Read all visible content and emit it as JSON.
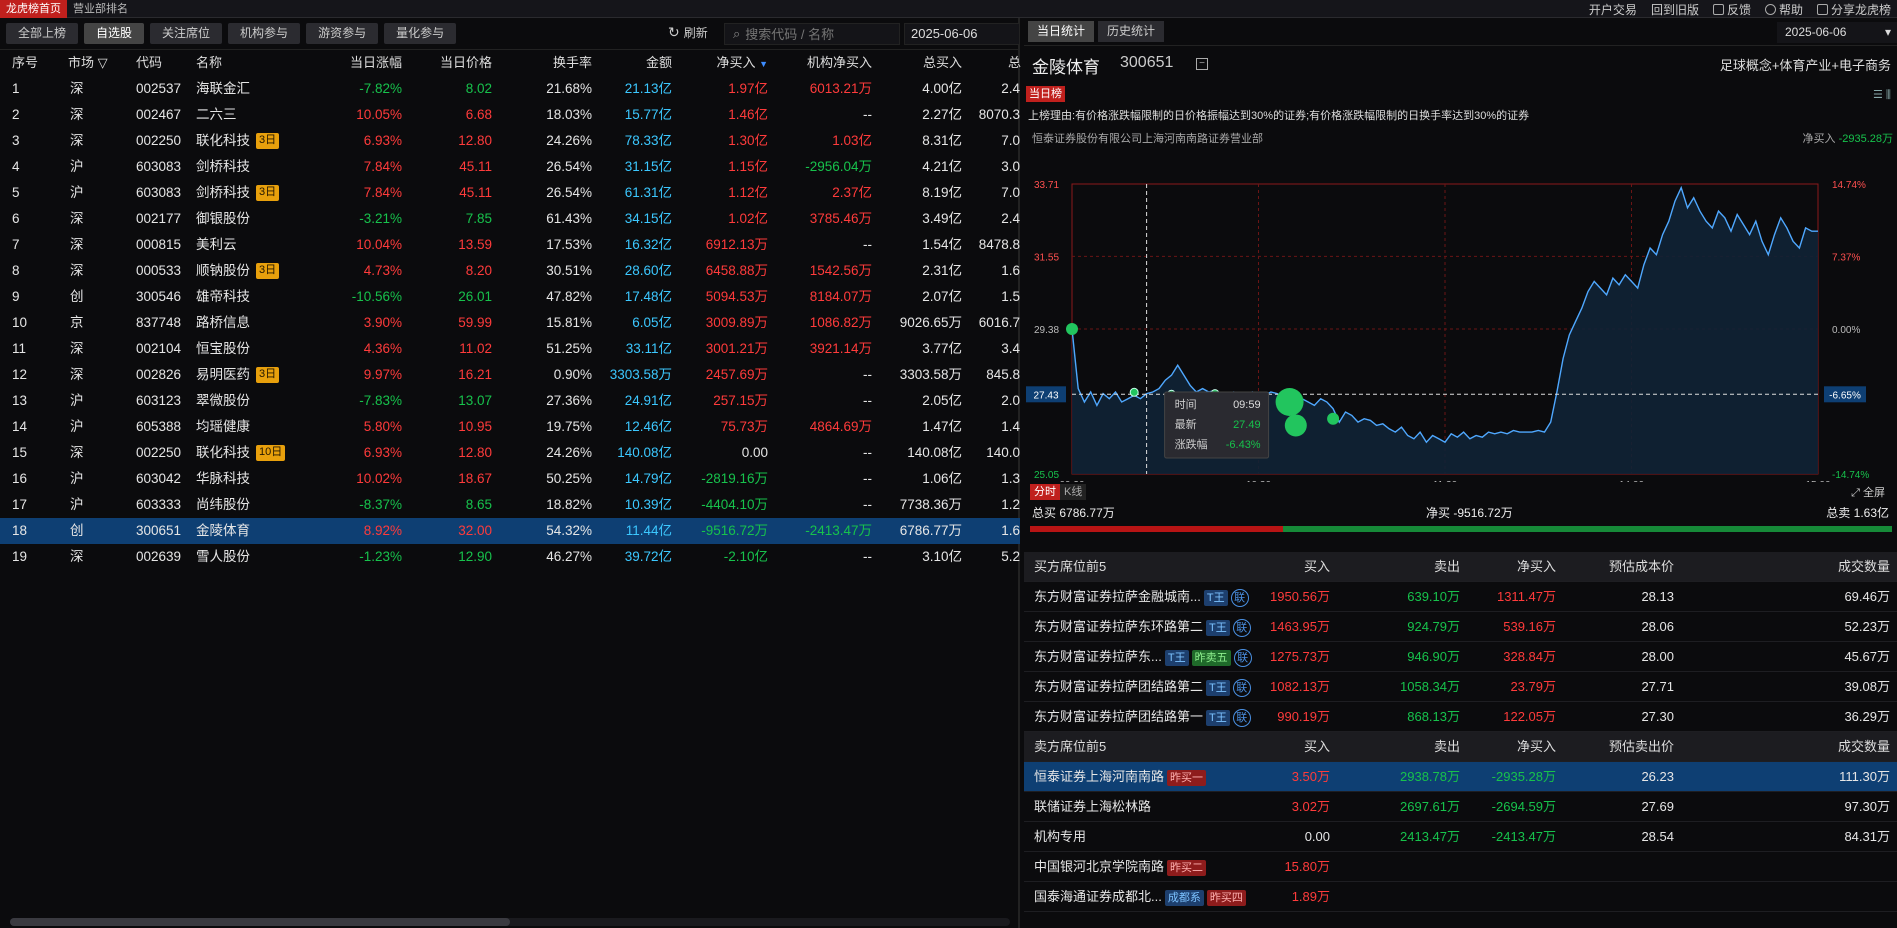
{
  "top": {
    "tabs": [
      "龙虎榜首页",
      "营业部排名"
    ],
    "right": [
      "开户交易",
      "回到旧版",
      "反馈",
      "帮助",
      "分享龙虎榜"
    ]
  },
  "filters": [
    "全部上榜",
    "自选股",
    "关注席位",
    "机构参与",
    "游资参与",
    "量化参与"
  ],
  "refresh_label": "刷新",
  "search_placeholder": "搜索代码 / 名称",
  "date": "2025-06-06",
  "table": {
    "headers": [
      "序号",
      "市场",
      "代码",
      "名称",
      "当日涨幅",
      "当日价格",
      "换手率",
      "金额",
      "净买入",
      "机构净买入",
      "总买入",
      "总"
    ],
    "rows": [
      {
        "no": "1",
        "mkt": "深",
        "code": "002537",
        "name": "海联金汇",
        "tag": "",
        "chg": "-7.82%",
        "price": "8.02",
        "turn": "21.68%",
        "amt": "21.13亿",
        "net": "1.97亿",
        "inst": "6013.21万",
        "buy": "4.00亿",
        "tot": "2.4"
      },
      {
        "no": "2",
        "mkt": "深",
        "code": "002467",
        "name": "二六三",
        "tag": "",
        "chg": "10.05%",
        "price": "6.68",
        "turn": "18.03%",
        "amt": "15.77亿",
        "net": "1.46亿",
        "inst": "--",
        "buy": "2.27亿",
        "tot": "8070.3"
      },
      {
        "no": "3",
        "mkt": "深",
        "code": "002250",
        "name": "联化科技",
        "tag": "3日",
        "chg": "6.93%",
        "price": "12.80",
        "turn": "24.26%",
        "amt": "78.33亿",
        "net": "1.30亿",
        "inst": "1.03亿",
        "buy": "8.31亿",
        "tot": "7.0"
      },
      {
        "no": "4",
        "mkt": "沪",
        "code": "603083",
        "name": "剑桥科技",
        "tag": "",
        "chg": "7.84%",
        "price": "45.11",
        "turn": "26.54%",
        "amt": "31.15亿",
        "net": "1.15亿",
        "inst": "-2956.04万",
        "buy": "4.21亿",
        "tot": "3.0"
      },
      {
        "no": "5",
        "mkt": "沪",
        "code": "603083",
        "name": "剑桥科技",
        "tag": "3日",
        "chg": "7.84%",
        "price": "45.11",
        "turn": "26.54%",
        "amt": "61.31亿",
        "net": "1.12亿",
        "inst": "2.37亿",
        "buy": "8.19亿",
        "tot": "7.0"
      },
      {
        "no": "6",
        "mkt": "深",
        "code": "002177",
        "name": "御银股份",
        "tag": "",
        "chg": "-3.21%",
        "price": "7.85",
        "turn": "61.43%",
        "amt": "34.15亿",
        "net": "1.02亿",
        "inst": "3785.46万",
        "buy": "3.49亿",
        "tot": "2.4"
      },
      {
        "no": "7",
        "mkt": "深",
        "code": "000815",
        "name": "美利云",
        "tag": "",
        "chg": "10.04%",
        "price": "13.59",
        "turn": "17.53%",
        "amt": "16.32亿",
        "net": "6912.13万",
        "inst": "--",
        "buy": "1.54亿",
        "tot": "8478.8"
      },
      {
        "no": "8",
        "mkt": "深",
        "code": "000533",
        "name": "顺钠股份",
        "tag": "3日",
        "chg": "4.73%",
        "price": "8.20",
        "turn": "30.51%",
        "amt": "28.60亿",
        "net": "6458.88万",
        "inst": "1542.56万",
        "buy": "2.31亿",
        "tot": "1.6"
      },
      {
        "no": "9",
        "mkt": "创",
        "code": "300546",
        "name": "雄帝科技",
        "tag": "",
        "chg": "-10.56%",
        "price": "26.01",
        "turn": "47.82%",
        "amt": "17.48亿",
        "net": "5094.53万",
        "inst": "8184.07万",
        "buy": "2.07亿",
        "tot": "1.5"
      },
      {
        "no": "10",
        "mkt": "京",
        "code": "837748",
        "name": "路桥信息",
        "tag": "",
        "chg": "3.90%",
        "price": "59.99",
        "turn": "15.81%",
        "amt": "6.05亿",
        "net": "3009.89万",
        "inst": "1086.82万",
        "buy": "9026.65万",
        "tot": "6016.7"
      },
      {
        "no": "11",
        "mkt": "深",
        "code": "002104",
        "name": "恒宝股份",
        "tag": "",
        "chg": "4.36%",
        "price": "11.02",
        "turn": "51.25%",
        "amt": "33.11亿",
        "net": "3001.21万",
        "inst": "3921.14万",
        "buy": "3.77亿",
        "tot": "3.4"
      },
      {
        "no": "12",
        "mkt": "深",
        "code": "002826",
        "name": "易明医药",
        "tag": "3日",
        "chg": "9.97%",
        "price": "16.21",
        "turn": "0.90%",
        "amt": "3303.58万",
        "net": "2457.69万",
        "inst": "--",
        "buy": "3303.58万",
        "tot": "845.8"
      },
      {
        "no": "13",
        "mkt": "沪",
        "code": "603123",
        "name": "翠微股份",
        "tag": "",
        "chg": "-7.83%",
        "price": "13.07",
        "turn": "27.36%",
        "amt": "24.91亿",
        "net": "257.15万",
        "inst": "--",
        "buy": "2.05亿",
        "tot": "2.0"
      },
      {
        "no": "14",
        "mkt": "沪",
        "code": "605388",
        "name": "均瑶健康",
        "tag": "",
        "chg": "5.80%",
        "price": "10.95",
        "turn": "19.75%",
        "amt": "12.46亿",
        "net": "75.73万",
        "inst": "4864.69万",
        "buy": "1.47亿",
        "tot": "1.4"
      },
      {
        "no": "15",
        "mkt": "深",
        "code": "002250",
        "name": "联化科技",
        "tag": "10日",
        "chg": "6.93%",
        "price": "12.80",
        "turn": "24.26%",
        "amt": "140.08亿",
        "net": "0.00",
        "inst": "--",
        "buy": "140.08亿",
        "tot": "140.0"
      },
      {
        "no": "16",
        "mkt": "沪",
        "code": "603042",
        "name": "华脉科技",
        "tag": "",
        "chg": "10.02%",
        "price": "18.67",
        "turn": "50.25%",
        "amt": "14.79亿",
        "net": "-2819.16万",
        "inst": "--",
        "buy": "1.06亿",
        "tot": "1.3"
      },
      {
        "no": "17",
        "mkt": "沪",
        "code": "603333",
        "name": "尚纬股份",
        "tag": "",
        "chg": "-8.37%",
        "price": "8.65",
        "turn": "18.82%",
        "amt": "10.39亿",
        "net": "-4404.10万",
        "inst": "--",
        "buy": "7738.36万",
        "tot": "1.2"
      },
      {
        "no": "18",
        "mkt": "创",
        "code": "300651",
        "name": "金陵体育",
        "tag": "",
        "chg": "8.92%",
        "price": "32.00",
        "turn": "54.32%",
        "amt": "11.44亿",
        "net": "-9516.72万",
        "inst": "-2413.47万",
        "buy": "6786.77万",
        "tot": "1.6"
      },
      {
        "no": "19",
        "mkt": "深",
        "code": "002639",
        "name": "雪人股份",
        "tag": "",
        "chg": "-1.23%",
        "price": "12.90",
        "turn": "46.27%",
        "amt": "39.72亿",
        "net": "-2.10亿",
        "inst": "--",
        "buy": "3.10亿",
        "tot": "5.2"
      }
    ]
  },
  "right": {
    "tabs": [
      "当日统计",
      "历史统计"
    ],
    "date": "2025-06-06",
    "stock_name": "金陵体育",
    "stock_code": "300651",
    "concept": "足球概念+体育产业+电子商务",
    "daily_badge": "当日榜",
    "reason": "上榜理由:有价格涨跌幅限制的日价格振幅达到30%的证券;有价格涨跌幅限制的日换手率达到30%的证券",
    "broker": "恒泰证券股份有限公司上海河南南路证券营业部",
    "net_buy_label": "净买入",
    "net_buy_value": "-2935.28万",
    "chart_tabs": [
      "分时",
      "K线"
    ],
    "fullscreen": "全屏",
    "summary": {
      "buy_label": "总买",
      "buy": "6786.77万",
      "net_label": "净买",
      "net": "-9516.72万",
      "sell_label": "总卖",
      "sell": "1.63亿"
    },
    "buy_header": [
      "买方席位前5",
      "买入",
      "卖出",
      "净买入",
      "预估成本价",
      "成交数量"
    ],
    "buy_rows": [
      {
        "name": "东方财富证券拉萨金融城南...",
        "tags": [
          {
            "t": "T王",
            "c": "t"
          }
        ],
        "lian": "联",
        "buy": "1950.56万",
        "sell": "639.10万",
        "net": "1311.47万",
        "cost": "28.13",
        "vol": "69.46万"
      },
      {
        "name": "东方财富证券拉萨东环路第二",
        "tags": [
          {
            "t": "T王",
            "c": "t"
          }
        ],
        "lian": "联",
        "buy": "1463.95万",
        "sell": "924.79万",
        "net": "539.16万",
        "cost": "28.06",
        "vol": "52.23万"
      },
      {
        "name": "东方财富证券拉萨东...",
        "tags": [
          {
            "t": "T王",
            "c": "t"
          },
          {
            "t": "昨卖五",
            "c": "g"
          }
        ],
        "lian": "联",
        "buy": "1275.73万",
        "sell": "946.90万",
        "net": "328.84万",
        "cost": "28.00",
        "vol": "45.67万"
      },
      {
        "name": "东方财富证券拉萨团结路第二",
        "tags": [
          {
            "t": "T王",
            "c": "t"
          }
        ],
        "lian": "联",
        "buy": "1082.13万",
        "sell": "1058.34万",
        "net": "23.79万",
        "cost": "27.71",
        "vol": "39.08万"
      },
      {
        "name": "东方财富证券拉萨团结路第一",
        "tags": [
          {
            "t": "T王",
            "c": "t"
          }
        ],
        "lian": "联",
        "buy": "990.19万",
        "sell": "868.13万",
        "net": "122.05万",
        "cost": "27.30",
        "vol": "36.29万"
      }
    ],
    "sell_header": [
      "卖方席位前5",
      "买入",
      "卖出",
      "净买入",
      "预估卖出价",
      "成交数量"
    ],
    "sell_rows": [
      {
        "name": "恒泰证券上海河南南路",
        "tags": [
          {
            "t": "昨买一",
            "c": "r"
          }
        ],
        "buy": "3.50万",
        "sell": "2938.78万",
        "net": "-2935.28万",
        "cost": "26.23",
        "vol": "111.30万"
      },
      {
        "name": "联储证券上海松林路",
        "tags": [],
        "buy": "3.02万",
        "sell": "2697.61万",
        "net": "-2694.59万",
        "cost": "27.69",
        "vol": "97.30万"
      },
      {
        "name": "机构专用",
        "tags": [],
        "buy": "0.00",
        "sell": "2413.47万",
        "net": "-2413.47万",
        "cost": "28.54",
        "vol": "84.31万"
      },
      {
        "name": "中国银河北京学院南路",
        "tags": [
          {
            "t": "昨买二",
            "c": "r"
          }
        ],
        "buy": "15.80万",
        "sell": "",
        "net": "",
        "cost": "",
        "vol": ""
      },
      {
        "name": "国泰海通证券成都北...",
        "tags": [
          {
            "t": "成都系",
            "c": "t"
          },
          {
            "t": "昨买四",
            "c": "r"
          }
        ],
        "buy": "1.89万",
        "sell": "",
        "net": "",
        "cost": "",
        "vol": ""
      }
    ]
  },
  "chart_data": {
    "type": "line",
    "title": "",
    "x_ticks": [
      "09:30",
      "10:30",
      "11:30",
      "14:00",
      "15:00"
    ],
    "y_left_ticks": [
      "33.71",
      "31.55",
      "29.38",
      "27.43",
      "25.05"
    ],
    "y_right_ticks": [
      "14.74%",
      "7.37%",
      "0.00%",
      "-6.65%",
      "-14.74%"
    ],
    "prev_close": 29.38,
    "ylim": [
      25.05,
      33.71
    ],
    "current_price_label": "27.43",
    "current_pct_label": "-6.65%",
    "series": [
      {
        "values": [
          29.38,
          27.6,
          27.2,
          27.5,
          27.1,
          27.45,
          27.3,
          27.5,
          27.2,
          27.3,
          27.4,
          27.3,
          27.45,
          27.5,
          27.6,
          27.85,
          28.0,
          28.3,
          28.0,
          27.7,
          27.5,
          27.6,
          27.5,
          27.55,
          27.45,
          27.4,
          27.5,
          27.45,
          27.4,
          27.5,
          27.35,
          27.4,
          27.5,
          27.45,
          27.3,
          27.4,
          27.5,
          27.3,
          27.2,
          27.1,
          27.3,
          27.2,
          27.0,
          26.6,
          26.9,
          26.8,
          26.6,
          26.7,
          26.65,
          26.5,
          26.55,
          26.4,
          26.3,
          26.45,
          26.2,
          26.1,
          26.3,
          26.0,
          26.2,
          26.1,
          26.0,
          26.25,
          26.15,
          26.3,
          26.1,
          26.2,
          26.15,
          26.3,
          26.25,
          26.3,
          26.25,
          26.35,
          26.3,
          26.3,
          26.3,
          26.35,
          26.3,
          26.6,
          27.5,
          28.5,
          29.2,
          29.6,
          30.0,
          30.5,
          30.8,
          30.6,
          30.4,
          30.9,
          30.7,
          31.0,
          30.8,
          30.6,
          31.3,
          31.8,
          31.6,
          32.2,
          32.6,
          33.2,
          33.6,
          33.0,
          33.3,
          32.9,
          32.6,
          32.4,
          32.9,
          32.7,
          32.3,
          32.8,
          32.5,
          32.2,
          32.6,
          32.0,
          31.6,
          32.2,
          32.7,
          32.4,
          32.0,
          31.8,
          32.4,
          32.3,
          32.3
        ]
      }
    ],
    "markers": [
      29.38,
      27.49,
      27.43,
      27.45,
      27.2,
      26.5,
      26.7
    ],
    "tooltip": {
      "time_label": "时间",
      "time": "09:59",
      "price_label": "最新",
      "price": "27.49",
      "pct_label": "涨跌幅",
      "pct": "-6.43%"
    }
  }
}
